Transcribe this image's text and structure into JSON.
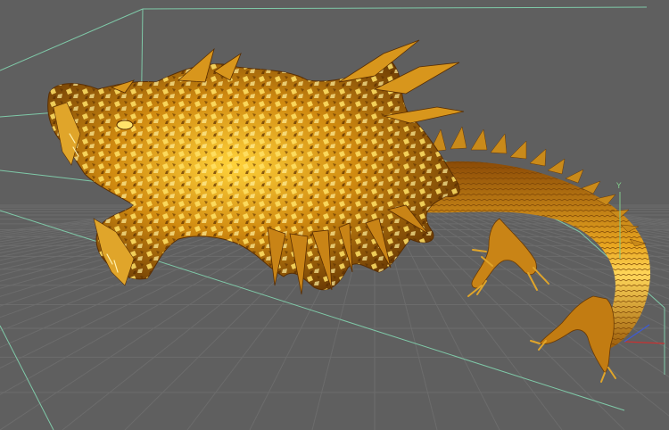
{
  "viewport": {
    "view": "perspective",
    "background_color": "#5f5f5f",
    "grid_color": "#6c6c6c",
    "frustum_line_color": "#7fc9a8",
    "model_color": "#d08a10",
    "model_highlight_color": "#ffd23a",
    "model_shadow_color": "#6a3a04",
    "model": "dragon",
    "axis": {
      "x_color": "#c83232",
      "y_color": "#7fc98a",
      "z_color": "#3c5ad8",
      "y_label": "Y"
    }
  }
}
